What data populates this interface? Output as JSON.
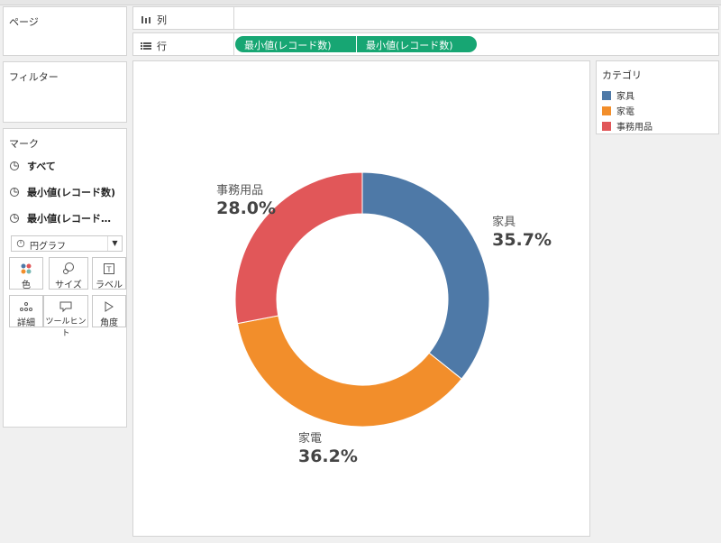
{
  "panels": {
    "pages_title": "ページ",
    "filters_title": "フィルター",
    "marks_title": "マーク"
  },
  "shelves": {
    "columns_label": "列",
    "rows_label": "行",
    "row_pills": [
      "最小値(レコード数)",
      "最小値(レコード数)"
    ]
  },
  "marks": {
    "rows": [
      "すべて",
      "最小値(レコード数)",
      "最小値(レコード…"
    ],
    "mark_type": "円グラフ",
    "buttons": [
      {
        "label": "色",
        "icon": "color-dots-icon"
      },
      {
        "label": "サイズ",
        "icon": "size-icon"
      },
      {
        "label": "ラベル",
        "icon": "label-icon"
      },
      {
        "label": "詳細",
        "icon": "detail-icon"
      },
      {
        "label": "ツールヒント",
        "icon": "tooltip-icon"
      },
      {
        "label": "角度",
        "icon": "angle-icon"
      }
    ]
  },
  "legend": {
    "title": "カテゴリ",
    "items": [
      {
        "label": "家具",
        "color": "#4e79a7"
      },
      {
        "label": "家電",
        "color": "#f28e2b"
      },
      {
        "label": "事務用品",
        "color": "#e15759"
      }
    ]
  },
  "chart_data": {
    "type": "pie",
    "donut": true,
    "categories": [
      "家具",
      "家電",
      "事務用品"
    ],
    "values": [
      35.7,
      36.2,
      28.0
    ],
    "value_labels": [
      "35.7%",
      "36.2%",
      "28.0%"
    ],
    "colors": [
      "#4e79a7",
      "#f28e2b",
      "#e15759"
    ],
    "start_angle_deg": 0,
    "direction": "clockwise",
    "legend_placement": "right"
  }
}
